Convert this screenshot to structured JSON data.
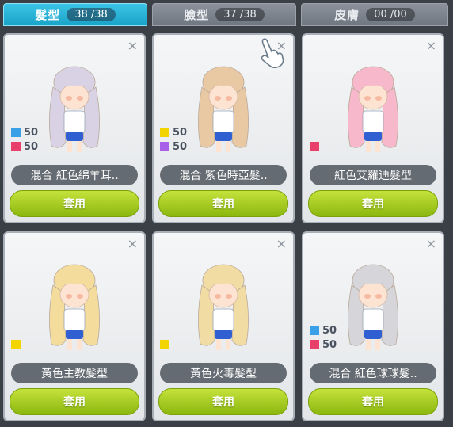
{
  "tabs": [
    {
      "label": "髮型",
      "count": "38 /38",
      "active": true
    },
    {
      "label": "臉型",
      "count": "37 /38",
      "active": false
    },
    {
      "label": "皮膚",
      "count": "00 /00",
      "active": false
    }
  ],
  "apply_label": "套用",
  "close_label": "×",
  "cards": [
    {
      "name": "混合 紅色綿羊耳..",
      "hair": "#d8d2e4",
      "stats": [
        {
          "color": "#3aa0e8",
          "value": "50"
        },
        {
          "color": "#e8406a",
          "value": "50"
        }
      ]
    },
    {
      "name": "混合 紫色時亞髮..",
      "hair": "#e8c9a4",
      "stats": [
        {
          "color": "#f2d400",
          "value": "50"
        },
        {
          "color": "#a860e8",
          "value": "50"
        }
      ]
    },
    {
      "name": "紅色艾羅迪髮型",
      "hair": "#f7b8cc",
      "stats": [
        {
          "color": "#e8406a",
          "value": ""
        }
      ]
    },
    {
      "name": "黃色主教髮型",
      "hair": "#f3dc9c",
      "stats": [
        {
          "color": "#f2d400",
          "value": ""
        }
      ]
    },
    {
      "name": "黃色火毒髮型",
      "hair": "#f1dca4",
      "stats": [
        {
          "color": "#f2d400",
          "value": ""
        }
      ]
    },
    {
      "name": "混合 紅色球球髮..",
      "hair": "#d6d6da",
      "stats": [
        {
          "color": "#3aa0e8",
          "value": "50"
        },
        {
          "color": "#e8406a",
          "value": "50"
        }
      ]
    }
  ]
}
